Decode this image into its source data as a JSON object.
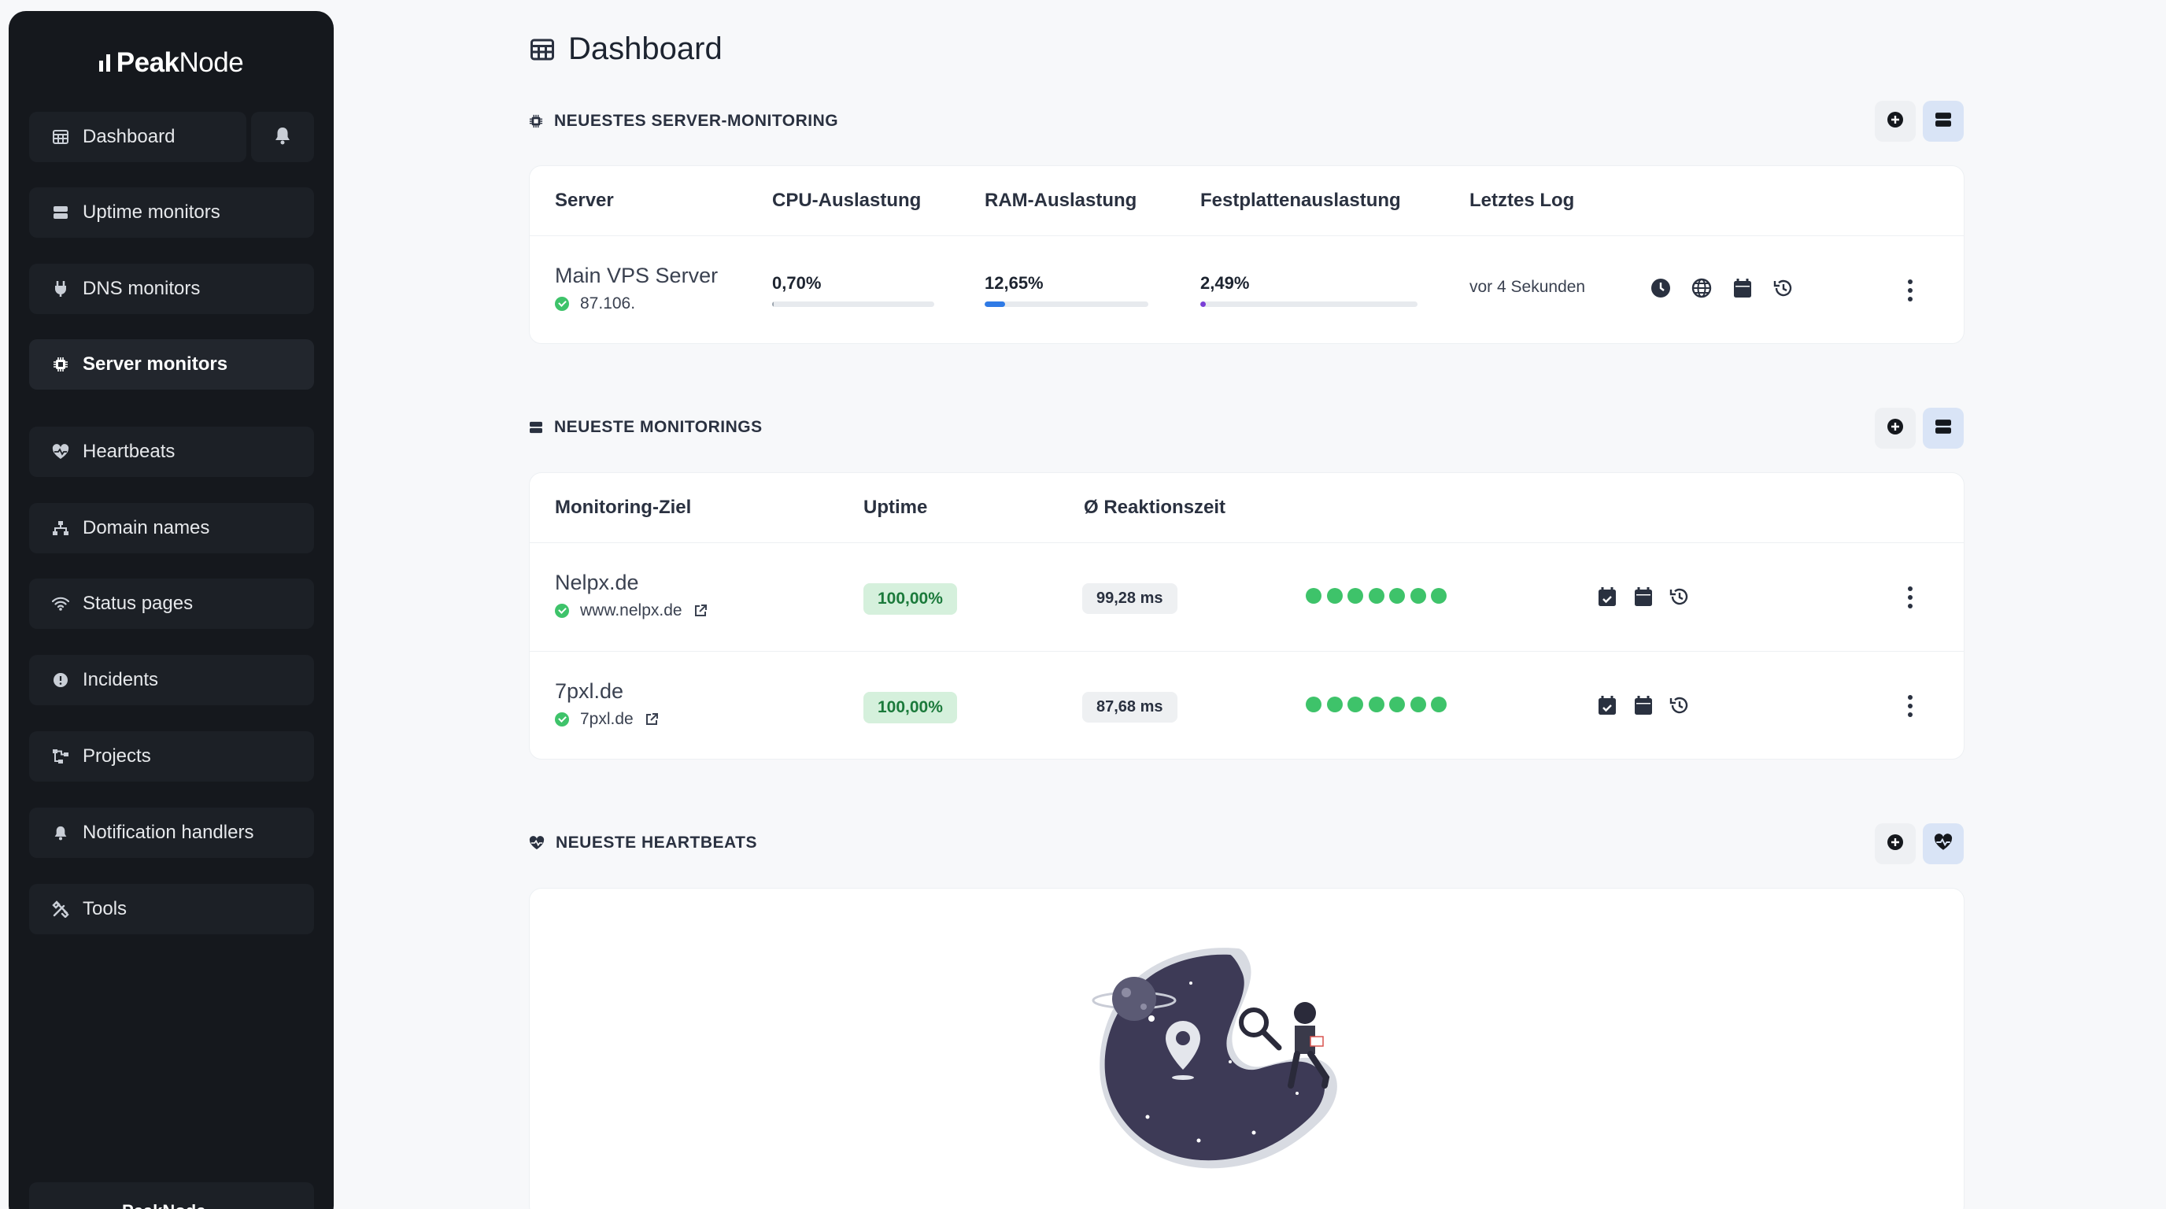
{
  "app": {
    "logo_bold": "Peak",
    "logo_light": "Node"
  },
  "sidebar": {
    "items": [
      {
        "label": "Dashboard",
        "icon": "table-icon"
      },
      {
        "label": "Uptime monitors",
        "icon": "server-icon"
      },
      {
        "label": "DNS monitors",
        "icon": "plug-icon"
      },
      {
        "label": "Server monitors",
        "icon": "cpu-icon"
      },
      {
        "label": "Heartbeats",
        "icon": "heart-pulse-icon"
      },
      {
        "label": "Domain names",
        "icon": "sitemap-icon"
      },
      {
        "label": "Status pages",
        "icon": "wifi-icon"
      },
      {
        "label": "Incidents",
        "icon": "alert-circle-icon"
      },
      {
        "label": "Projects",
        "icon": "diagram-icon"
      },
      {
        "label": "Notification handlers",
        "icon": "bell-icon"
      },
      {
        "label": "Tools",
        "icon": "tools-icon"
      }
    ],
    "active": "Server monitors",
    "user_label": "PeakNode"
  },
  "main": {
    "title": "Dashboard",
    "server_section": {
      "title": "NEUESTES SERVER-MONITORING",
      "columns": [
        "Server",
        "CPU-Auslastung",
        "RAM-Auslastung",
        "Festplattenauslastung",
        "Letztes Log"
      ],
      "rows": [
        {
          "name": "Main VPS Server",
          "ip": "87.106.",
          "cpu": "0,70%",
          "cpu_value": 0.7,
          "ram": "12,65%",
          "ram_value": 12.65,
          "disk": "2,49%",
          "disk_value": 2.49,
          "last_log": "vor 4 Sekunden"
        }
      ]
    },
    "monitor_section": {
      "title": "NEUESTE MONITORINGS",
      "columns": [
        "Monitoring-Ziel",
        "Uptime",
        "Ø Reaktionszeit"
      ],
      "rows": [
        {
          "name": "Nelpx.de",
          "url": "www.nelpx.de",
          "uptime": "100,00%",
          "response": "99,28 ms",
          "checks": 7
        },
        {
          "name": "7pxl.de",
          "url": "7pxl.de",
          "uptime": "100,00%",
          "response": "87,68 ms",
          "checks": 7
        }
      ]
    },
    "heartbeat_section": {
      "title": "NEUESTE HEARTBEATS"
    }
  },
  "colors": {
    "sidebar_bg": "#15181d",
    "success": "#3ec36a",
    "ram_bar": "#2f7ae5",
    "disk_bar": "#7a3fd6",
    "cpu_bar": "#9aa3ad",
    "empty_illustration": "#3d3a56"
  }
}
